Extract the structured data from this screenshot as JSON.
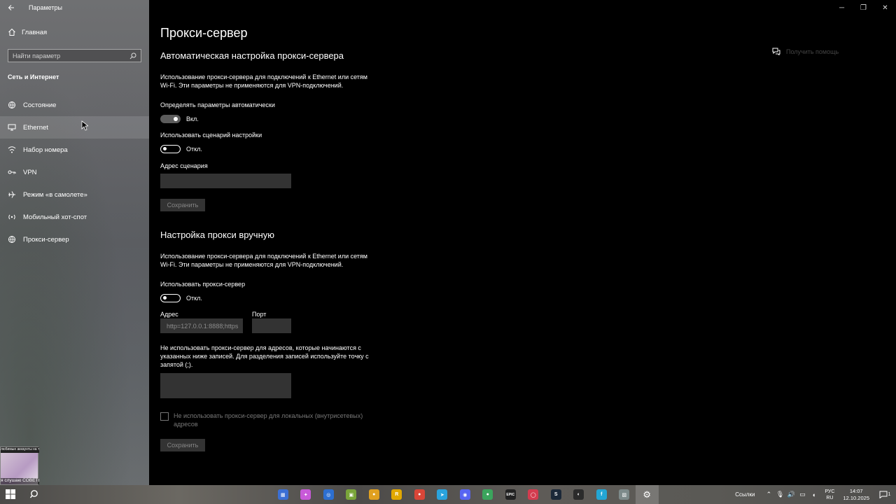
{
  "window": {
    "title": "Параметры",
    "help_label": "Получить помощь"
  },
  "sidebar": {
    "home_label": "Главная",
    "search_placeholder": "Найти параметр",
    "section_title": "Сеть и Интернет",
    "items": [
      {
        "label": "Состояние",
        "icon": "globe-status-icon"
      },
      {
        "label": "Ethernet",
        "icon": "ethernet-icon"
      },
      {
        "label": "Набор номера",
        "icon": "dialup-icon"
      },
      {
        "label": "VPN",
        "icon": "vpn-icon"
      },
      {
        "label": "Режим «в самолете»",
        "icon": "airplane-icon"
      },
      {
        "label": "Мобильный хот-спот",
        "icon": "hotspot-icon"
      },
      {
        "label": "Прокси-сервер",
        "icon": "globe-icon"
      }
    ],
    "thumbnail": {
      "top_text": "любимые аккаунты на теле",
      "bottom_text": "я слушаю СОВЕТЫ"
    }
  },
  "main": {
    "page_title": "Прокси-сервер",
    "auto": {
      "heading": "Автоматическая настройка прокси-сервера",
      "description": "Использование прокси-сервера для подключений к Ethernet или сетям Wi-Fi. Эти параметры не применяются для VPN-подключений.",
      "detect_label": "Определять параметры автоматически",
      "detect_state": "Вкл.",
      "script_label": "Использовать сценарий настройки",
      "script_state": "Откл.",
      "address_label": "Адрес сценария",
      "address_value": "",
      "save_label": "Сохранить"
    },
    "manual": {
      "heading": "Настройка прокси вручную",
      "description": "Использование прокси-сервера для подключений к Ethernet или сетям Wi-Fi. Эти параметры не применяются для VPN-подключений.",
      "use_label": "Использовать прокси-сервер",
      "use_state": "Откл.",
      "address_label": "Адрес",
      "address_value": "http=127.0.0.1:8888;https",
      "port_label": "Порт",
      "port_value": "",
      "exceptions_text": "Не использовать прокси-сервер для адресов, которые начинаются с указанных ниже записей. Для разделения записей используйте точку с запятой (;).",
      "exceptions_value": "",
      "local_checkbox_label": "Не использовать прокси-сервер для локальных (внутрисетевых) адресов",
      "save_label": "Сохранить"
    }
  },
  "taskbar": {
    "links_label": "Ссылки",
    "lang_top": "РУС",
    "lang_bottom": "RU",
    "time": "14:07",
    "date": "12.10.2025",
    "notification_count": "1",
    "apps": [
      {
        "name": "app-calculator-icon",
        "label": "▦",
        "color": "#3b6fd4"
      },
      {
        "name": "app-copilot-icon",
        "label": "✦",
        "color": "#c85ad8"
      },
      {
        "name": "app-ubisoft-icon",
        "label": "◎",
        "color": "#2d6fd1"
      },
      {
        "name": "app-minecraft-icon",
        "label": "▣",
        "color": "#7aa53a"
      },
      {
        "name": "app-chrome-icon",
        "label": "●",
        "color": "#e0a020"
      },
      {
        "name": "app-rockstar-icon",
        "label": "R",
        "color": "#e2a800"
      },
      {
        "name": "app-chrome2-icon",
        "label": "●",
        "color": "#d94638"
      },
      {
        "name": "app-telegram-icon",
        "label": "➤",
        "color": "#2aa3dd"
      },
      {
        "name": "app-discord-icon",
        "label": "◉",
        "color": "#5865f2"
      },
      {
        "name": "app-chrome3-icon",
        "label": "●",
        "color": "#3ba55d"
      },
      {
        "name": "app-epic-icon",
        "label": "EPIC",
        "color": "#222222"
      },
      {
        "name": "app-opera-gx-icon",
        "label": "◯",
        "color": "#d33c4f"
      },
      {
        "name": "app-steam-icon",
        "label": "S",
        "color": "#1b2838"
      },
      {
        "name": "app-obs-icon",
        "label": "◐",
        "color": "#2b2b2b"
      },
      {
        "name": "app-faceit-icon",
        "label": "f",
        "color": "#23a6d5"
      },
      {
        "name": "app-editor-icon",
        "label": "▧",
        "color": "#7d8a8a"
      },
      {
        "name": "app-settings-icon",
        "label": "⚙",
        "color": "transparent"
      }
    ]
  }
}
